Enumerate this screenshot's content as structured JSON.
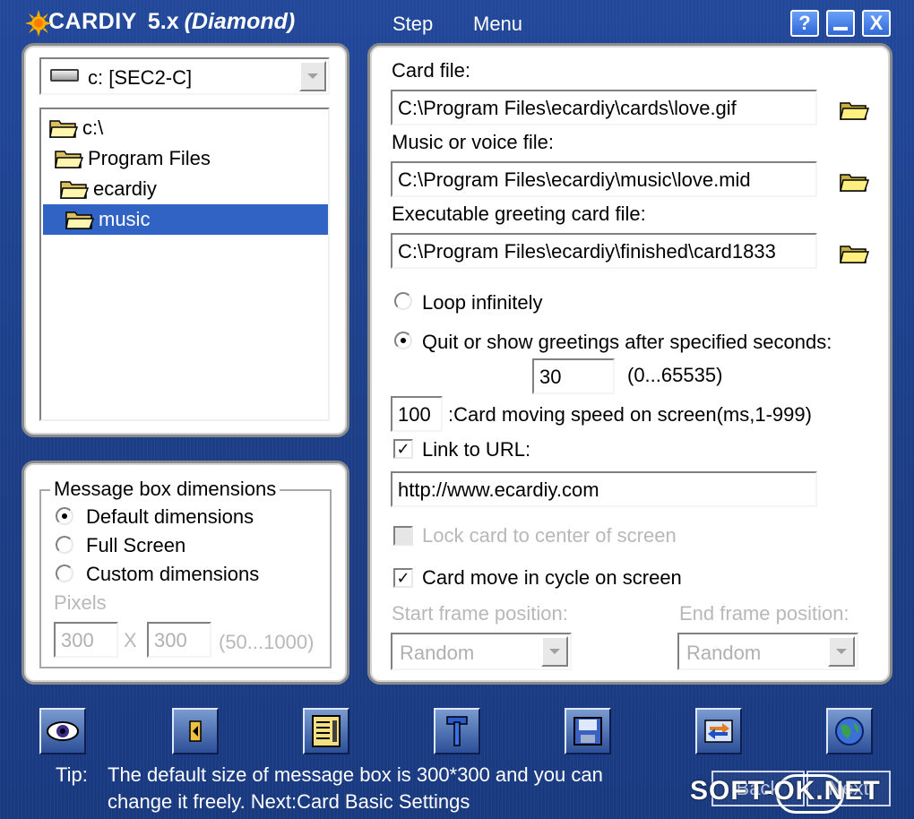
{
  "app": {
    "logo_text": "CARDIY",
    "version": "5.x",
    "edition": "(Diamond)",
    "menu": [
      "Step",
      "Menu"
    ],
    "window_buttons": [
      "?",
      "_",
      "X"
    ]
  },
  "file_browser": {
    "drive": "c: [SEC2-C]",
    "tree": [
      {
        "label": "c:\\",
        "selected": false
      },
      {
        "label": "Program Files",
        "selected": false
      },
      {
        "label": "ecardiy",
        "selected": false
      },
      {
        "label": "music",
        "selected": true
      }
    ]
  },
  "message_box": {
    "title": "Message box dimensions",
    "options": [
      "Default dimensions",
      "Full Screen",
      "Custom dimensions"
    ],
    "selected": "Default dimensions",
    "pixels_label": "Pixels",
    "width": "300",
    "x_label": "X",
    "height": "300",
    "range": "(50...1000)"
  },
  "settings": {
    "card_file_label": "Card file:",
    "card_file": "C:\\Program Files\\ecardiy\\cards\\love.gif",
    "music_file_label": "Music or voice file:",
    "music_file": "C:\\Program Files\\ecardiy\\music\\love.mid",
    "exe_file_label": "Executable greeting card file:",
    "exe_file": "C:\\Program Files\\ecardiy\\finished\\card1833",
    "loop_label": "Loop infinitely",
    "quit_label": "Quit or show greetings after specified seconds:",
    "seconds": "30",
    "seconds_range": "(0...65535)",
    "speed": "100",
    "speed_label": ":Card moving speed on screen(ms,1-999)",
    "link_label": "Link to URL:",
    "link_checked": true,
    "url": "http://www.ecardiy.com",
    "lock_label": "Lock card to center of screen",
    "cycle_label": "Card move in cycle on screen",
    "cycle_checked": true,
    "start_frame_label": "Start frame position:",
    "start_frame": "Random",
    "end_frame_label": "End frame position:",
    "end_frame": "Random"
  },
  "toolbar_icons": [
    "eye-icon",
    "speaker-icon",
    "document-icon",
    "tools-icon",
    "save-icon",
    "exchange-icon",
    "globe-icon"
  ],
  "tip": {
    "label": "Tip:",
    "line1": "The default size of message box is 300*300 and you can",
    "line2": "change it freely. Next:Card Basic Settings"
  },
  "nav": {
    "back": "Back",
    "next": "Next"
  },
  "watermark": "SOFT-OK.NET",
  "colors": {
    "background": "#1c3f88",
    "selection": "#3163c5",
    "panel": "#ffffff"
  }
}
